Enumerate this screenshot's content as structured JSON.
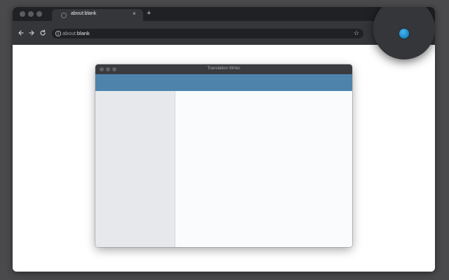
{
  "browser": {
    "tab": {
      "title": "about:blank",
      "close_glyph": "×"
    },
    "new_tab_glyph": "+",
    "omnibox": {
      "url_host": "about:",
      "url_path": "blank"
    },
    "icons": {
      "back": "arrow-left-icon",
      "forward": "arrow-right-icon",
      "reload": "reload-icon",
      "info": "info-icon",
      "bookmark": "star-icon",
      "menu": "kebab-menu-icon",
      "extension": "extension-icon"
    },
    "star_glyph": "☆",
    "menu_glyph": "⋮"
  },
  "inner_app": {
    "title": "Translation Writer",
    "colors": {
      "banner": "#4e83ac",
      "sidebar": "#e6e8ec",
      "main": "#fafbfc"
    }
  },
  "colors": {
    "desktop": "#4a4a4c",
    "tabstrip": "#202124",
    "toolbar": "#35363a",
    "extension_accent": "#1e8fd0"
  }
}
